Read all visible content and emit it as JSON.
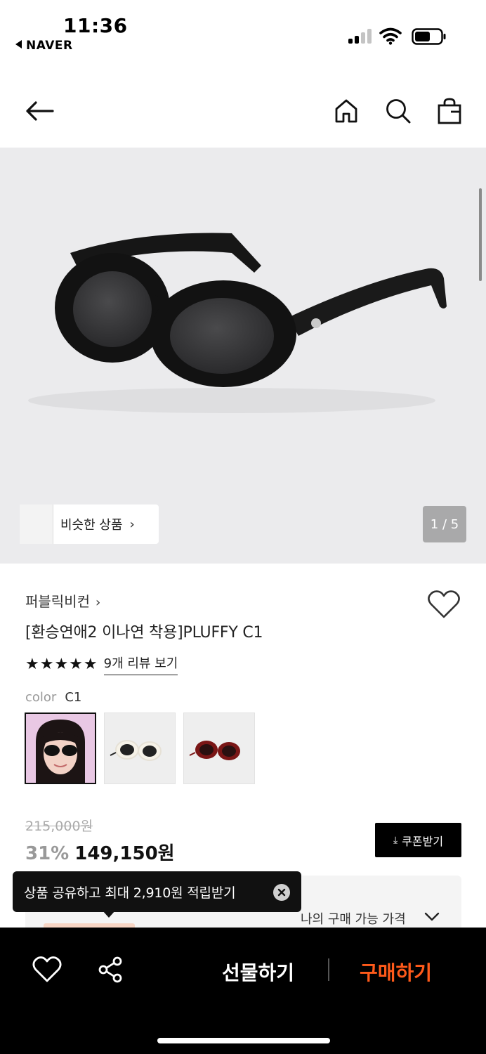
{
  "status_bar": {
    "time": "11:36",
    "back_app": "NAVER"
  },
  "nav": {
    "icons": [
      "back-arrow-icon",
      "home-icon",
      "search-icon",
      "shopping-bag-icon"
    ]
  },
  "gallery": {
    "similar_label": "비슷한 상품",
    "chevron": "›",
    "pager": "1 / 5"
  },
  "product": {
    "brand": "퍼블릭비컨",
    "brand_chevron": "›",
    "title": "[환승연애2 이나연 착용]PLUFFY C1",
    "stars": "★★★★★",
    "rating_fraction": 1.0,
    "review_link": "9개 리뷰 보기",
    "color_label": "color",
    "color_value": "C1",
    "swatches": [
      "C1",
      "C2",
      "C3"
    ],
    "old_price": "215,000원",
    "discount": "31%",
    "price": "149,150원",
    "coupon_button": "쿠폰받기",
    "my_price_label": "나의 구매 가능 가격"
  },
  "tooltip": {
    "text": "상품 공유하고 최대 2,910원 적립받기"
  },
  "bottom_bar": {
    "gift": "선물하기",
    "buy": "구매하기"
  },
  "colors": {
    "accent_orange": "#ff5a1a",
    "bottom_bar_bg": "#000000",
    "gallery_bg": "#ebebed"
  }
}
